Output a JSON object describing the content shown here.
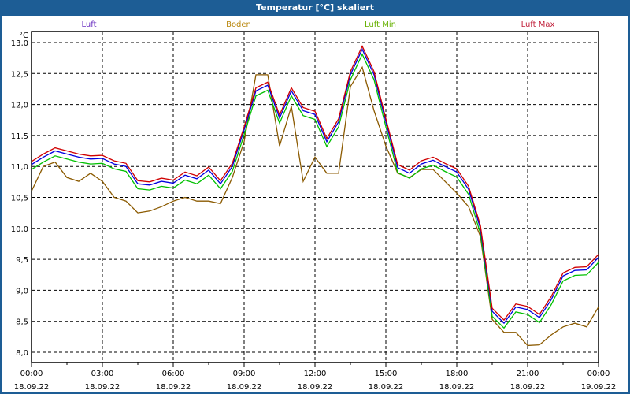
{
  "window": {
    "title": "Temperatur [°C] skaliert"
  },
  "chart_data": {
    "type": "line",
    "title": "Temperatur [°C] skaliert",
    "ylabel": "°C",
    "xlabel": "",
    "ylim": [
      7.85,
      13.2
    ],
    "xlim_hours": [
      0,
      24
    ],
    "grid": true,
    "legend_placement": "top",
    "y_ticks": [
      "8,0",
      "8,5",
      "9,0",
      "9,5",
      "10,0",
      "10,5",
      "11,0",
      "11,5",
      "12,0",
      "12,5",
      "13,0"
    ],
    "y_tick_values": [
      8.0,
      8.5,
      9.0,
      9.5,
      10.0,
      10.5,
      11.0,
      11.5,
      12.0,
      12.5,
      13.0
    ],
    "x_ticks": [
      {
        "time": "00:00",
        "date": "18.09.22",
        "hour": 0
      },
      {
        "time": "03:00",
        "date": "18.09.22",
        "hour": 3
      },
      {
        "time": "06:00",
        "date": "18.09.22",
        "hour": 6
      },
      {
        "time": "09:00",
        "date": "18.09.22",
        "hour": 9
      },
      {
        "time": "12:00",
        "date": "18.09.22",
        "hour": 12
      },
      {
        "time": "15:00",
        "date": "18.09.22",
        "hour": 15
      },
      {
        "time": "18:00",
        "date": "18.09.22",
        "hour": 18
      },
      {
        "time": "21:00",
        "date": "18.09.22",
        "hour": 21
      },
      {
        "time": "00:00",
        "date": "19.09.22",
        "hour": 24
      }
    ],
    "x_step_hours": 0.5,
    "series": [
      {
        "name": "Boden",
        "color": "#8b5a00",
        "legend_color": "#b8860b",
        "values": [
          10.6,
          11.0,
          11.07,
          10.82,
          10.76,
          10.89,
          10.76,
          10.5,
          10.44,
          10.25,
          10.28,
          10.35,
          10.44,
          10.5,
          10.44,
          10.44,
          10.4,
          10.82,
          11.4,
          12.48,
          12.48,
          11.33,
          11.97,
          10.76,
          11.15,
          10.89,
          10.89,
          12.29,
          12.6,
          11.9,
          11.33,
          10.89,
          10.82,
          10.95,
          10.95,
          10.76,
          10.57,
          10.35,
          9.87,
          8.53,
          8.32,
          8.32,
          8.11,
          8.12,
          8.28,
          8.41,
          8.47,
          8.41,
          8.73
        ]
      },
      {
        "name": "Luft Min",
        "color": "#00c000",
        "legend_color": "#66b000",
        "values": [
          10.95,
          11.07,
          11.17,
          11.12,
          11.07,
          11.04,
          11.05,
          10.96,
          10.92,
          10.64,
          10.62,
          10.68,
          10.65,
          10.78,
          10.72,
          10.86,
          10.64,
          10.92,
          11.51,
          12.14,
          12.23,
          11.7,
          12.14,
          11.82,
          11.76,
          11.32,
          11.64,
          12.4,
          12.81,
          12.4,
          11.64,
          10.9,
          10.81,
          10.96,
          11.02,
          10.92,
          10.83,
          10.55,
          9.92,
          8.58,
          8.39,
          8.65,
          8.61,
          8.48,
          8.77,
          9.15,
          9.24,
          9.25,
          9.45
        ]
      },
      {
        "name": "Luft",
        "color": "#0000e0",
        "legend_color": "#6a2fc0",
        "values": [
          11.03,
          11.15,
          11.25,
          11.2,
          11.15,
          11.12,
          11.13,
          11.04,
          11.0,
          10.72,
          10.7,
          10.76,
          10.73,
          10.86,
          10.8,
          10.94,
          10.72,
          11.0,
          11.59,
          12.22,
          12.31,
          11.78,
          12.22,
          11.9,
          11.84,
          11.4,
          11.72,
          12.48,
          12.89,
          12.48,
          11.72,
          10.98,
          10.89,
          11.04,
          11.1,
          11.0,
          10.91,
          10.63,
          10.0,
          8.66,
          8.47,
          8.73,
          8.69,
          8.56,
          8.85,
          9.23,
          9.32,
          9.33,
          9.53
        ]
      },
      {
        "name": "Luft Max",
        "color": "#d00000",
        "legend_color": "#c0203a",
        "values": [
          11.08,
          11.2,
          11.3,
          11.25,
          11.2,
          11.17,
          11.18,
          11.09,
          11.05,
          10.77,
          10.75,
          10.81,
          10.78,
          10.91,
          10.85,
          10.99,
          10.77,
          11.05,
          11.64,
          12.27,
          12.36,
          11.83,
          12.27,
          11.95,
          11.89,
          11.45,
          11.77,
          12.53,
          12.94,
          12.53,
          11.77,
          11.03,
          10.94,
          11.09,
          11.15,
          11.05,
          10.96,
          10.68,
          10.05,
          8.71,
          8.52,
          8.78,
          8.74,
          8.61,
          8.9,
          9.28,
          9.37,
          9.38,
          9.58
        ]
      }
    ],
    "legend_order": [
      "Luft",
      "Boden",
      "Luft Min",
      "Luft Max"
    ]
  }
}
